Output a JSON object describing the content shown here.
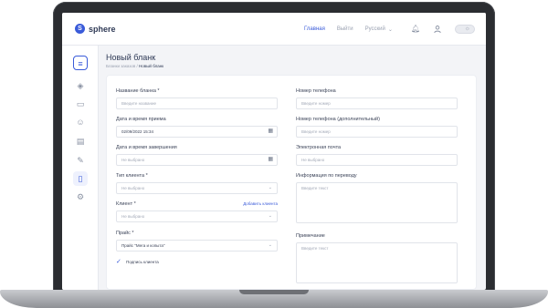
{
  "app": {
    "logo_text": "sphere",
    "logo_letter": "S"
  },
  "topnav": {
    "main": "Главная",
    "logout": "Выйти",
    "language": "Русский"
  },
  "sidebar": {
    "icons": [
      "menu-icon",
      "layers-icon",
      "folder-icon",
      "users-icon",
      "id-card-icon",
      "document-edit-icon",
      "document-icon",
      "settings-icon"
    ]
  },
  "page": {
    "title": "Новый бланк",
    "breadcrumb_parent": "Бланки заказов",
    "breadcrumb_sep": "/",
    "breadcrumb_current": "Новый бланк"
  },
  "form": {
    "name": {
      "label": "Название бланка *",
      "placeholder": "Введите название"
    },
    "received": {
      "label": "Дата и время приема",
      "value": "02/09/2022 15:34"
    },
    "completed": {
      "label": "Дата и время завершения",
      "placeholder": "Не выбрано"
    },
    "client_type": {
      "label": "Тип клиента *",
      "placeholder": "Не выбрано"
    },
    "client": {
      "label": "Клиент *",
      "placeholder": "Не выбрано",
      "add_link": "Добавить клиента"
    },
    "price": {
      "label": "Прайс *",
      "value": "Прайс \"Мега и копыта\""
    },
    "signature": {
      "label": "Подпись клиента",
      "checked": true
    },
    "phone": {
      "label": "Номер телефона",
      "placeholder": "Введите номер"
    },
    "phone2": {
      "label": "Номер телефона (дополнительный)",
      "placeholder": "Введите номер"
    },
    "email": {
      "label": "Электронная почта",
      "placeholder": "Не выбрано"
    },
    "transfer_info": {
      "label": "Информация по переводу",
      "placeholder": "Введите текст"
    },
    "note": {
      "label": "Примечание",
      "placeholder": "Введите текст"
    }
  },
  "colors": {
    "accent": "#3a5bd9",
    "text": "#2f3a56",
    "muted": "#9aa1b1"
  }
}
